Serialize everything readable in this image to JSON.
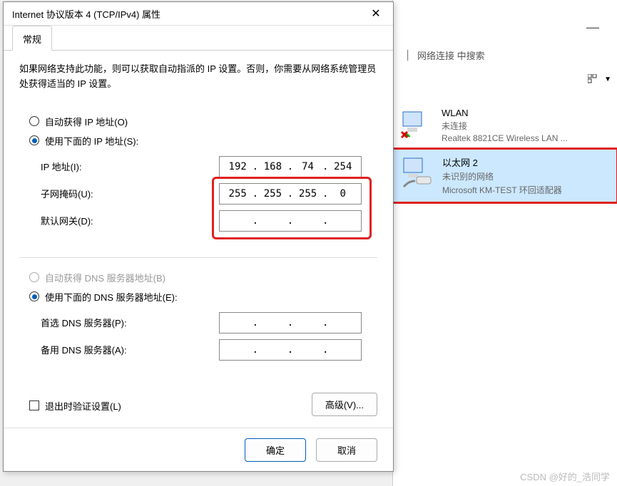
{
  "dialog": {
    "title": "Internet 协议版本 4 (TCP/IPv4) 属性",
    "tab_general": "常规",
    "description": "如果网络支持此功能，则可以获取自动指派的 IP 设置。否则，你需要从网络系统管理员处获得适当的 IP 设置。",
    "opt_auto_ip": "自动获得 IP 地址(O)",
    "opt_manual_ip": "使用下面的 IP 地址(S):",
    "lbl_ip": "IP 地址(I):",
    "lbl_mask": "子网掩码(U):",
    "lbl_gateway": "默认网关(D):",
    "ip": [
      "192",
      "168",
      "74",
      "254"
    ],
    "mask": [
      "255",
      "255",
      "255",
      "0"
    ],
    "gateway": [
      "",
      "",
      "",
      ""
    ],
    "opt_auto_dns": "自动获得 DNS 服务器地址(B)",
    "opt_manual_dns": "使用下面的 DNS 服务器地址(E):",
    "lbl_dns1": "首选 DNS 服务器(P):",
    "lbl_dns2": "备用 DNS 服务器(A):",
    "dns1": [
      "",
      "",
      "",
      ""
    ],
    "dns2": [
      "",
      "",
      "",
      ""
    ],
    "chk_validate": "退出时验证设置(L)",
    "btn_advanced": "高级(V)...",
    "btn_ok": "确定",
    "btn_cancel": "取消"
  },
  "explorer": {
    "search_placeholder": "网络连接 中搜索",
    "items": [
      {
        "name": "WLAN",
        "status": "未连接",
        "adapter": "Realtek 8821CE Wireless LAN ..."
      },
      {
        "name": "以太网 2",
        "status": "未识别的网络",
        "adapter": "Microsoft KM-TEST 环回适配器"
      }
    ]
  },
  "watermark": "CSDN @好的_浩同学"
}
